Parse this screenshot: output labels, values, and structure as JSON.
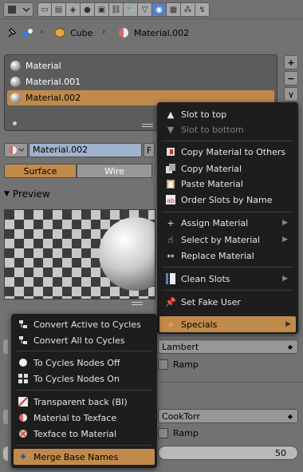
{
  "breadcrumb": {
    "object": "Cube",
    "material": "Material.002"
  },
  "slots": [
    {
      "label": "Material",
      "selected": false
    },
    {
      "label": "Material.001",
      "selected": false
    },
    {
      "label": "Material.002",
      "selected": true
    }
  ],
  "side_buttons": {
    "add": "+",
    "remove": "−",
    "specials": "∨"
  },
  "material_field": {
    "value": "Material.002",
    "fake_user": "F"
  },
  "type_tabs": {
    "surface": "Surface",
    "wire": "Wire"
  },
  "preview": {
    "title": "Preview"
  },
  "fields": {
    "diffuse_shader": "Lambert",
    "specular_shader": "CookTorr",
    "ramp1": "Ramp",
    "ramp2": "Ramp",
    "hardness": "50"
  },
  "slot_menu": {
    "items": [
      {
        "label": "Slot to top",
        "icon": "triangle-up-icon",
        "disabled": false
      },
      {
        "label": "Slot to bottom",
        "icon": "triangle-down-icon",
        "disabled": true
      },
      {
        "label": "Copy Material to Others",
        "icon": "copy-others-icon",
        "disabled": false
      },
      {
        "label": "Copy Material",
        "icon": "copy-icon",
        "disabled": false
      },
      {
        "label": "Paste Material",
        "icon": "paste-icon",
        "disabled": false
      },
      {
        "label": "Order Slots by Name",
        "icon": "sort-alpha-icon",
        "disabled": false
      },
      {
        "label": "Assign Material",
        "icon": "plus-icon",
        "disabled": false,
        "submenu": true
      },
      {
        "label": "Select by Material",
        "icon": "hand-pointer-icon",
        "disabled": false,
        "submenu": true
      },
      {
        "label": "Replace Material",
        "icon": "swap-arrows-icon",
        "disabled": false
      },
      {
        "label": "Clean Slots",
        "icon": "clean-slots-icon",
        "disabled": false,
        "submenu": true
      },
      {
        "label": "Set Fake User",
        "icon": "pin-icon",
        "disabled": false
      },
      {
        "label": "Specials",
        "icon": "star-icon",
        "disabled": false,
        "submenu": true,
        "highlighted": true
      }
    ]
  },
  "specials_menu": {
    "items": [
      {
        "label": "Convert Active to Cycles",
        "icon": "node-tree-icon"
      },
      {
        "label": "Convert All to Cycles",
        "icon": "node-tree-icon"
      },
      {
        "label": "To Cycles Nodes Off",
        "icon": "sphere-icon"
      },
      {
        "label": "To Cycles Nodes On",
        "icon": "nodes-icon"
      },
      {
        "label": "Transparent back (BI)",
        "icon": "transparent-icon"
      },
      {
        "label": "Material to Texface",
        "icon": "material-icon"
      },
      {
        "label": "Texface to Material",
        "icon": "texface-icon"
      },
      {
        "label": "Merge Base Names",
        "icon": "diamond-icon",
        "highlighted": true
      }
    ]
  },
  "colors": {
    "accent": "#c08a4b",
    "menu_bg": "#1d1d1d",
    "panel_bg": "#727272",
    "active_tab": "#5680c2"
  }
}
